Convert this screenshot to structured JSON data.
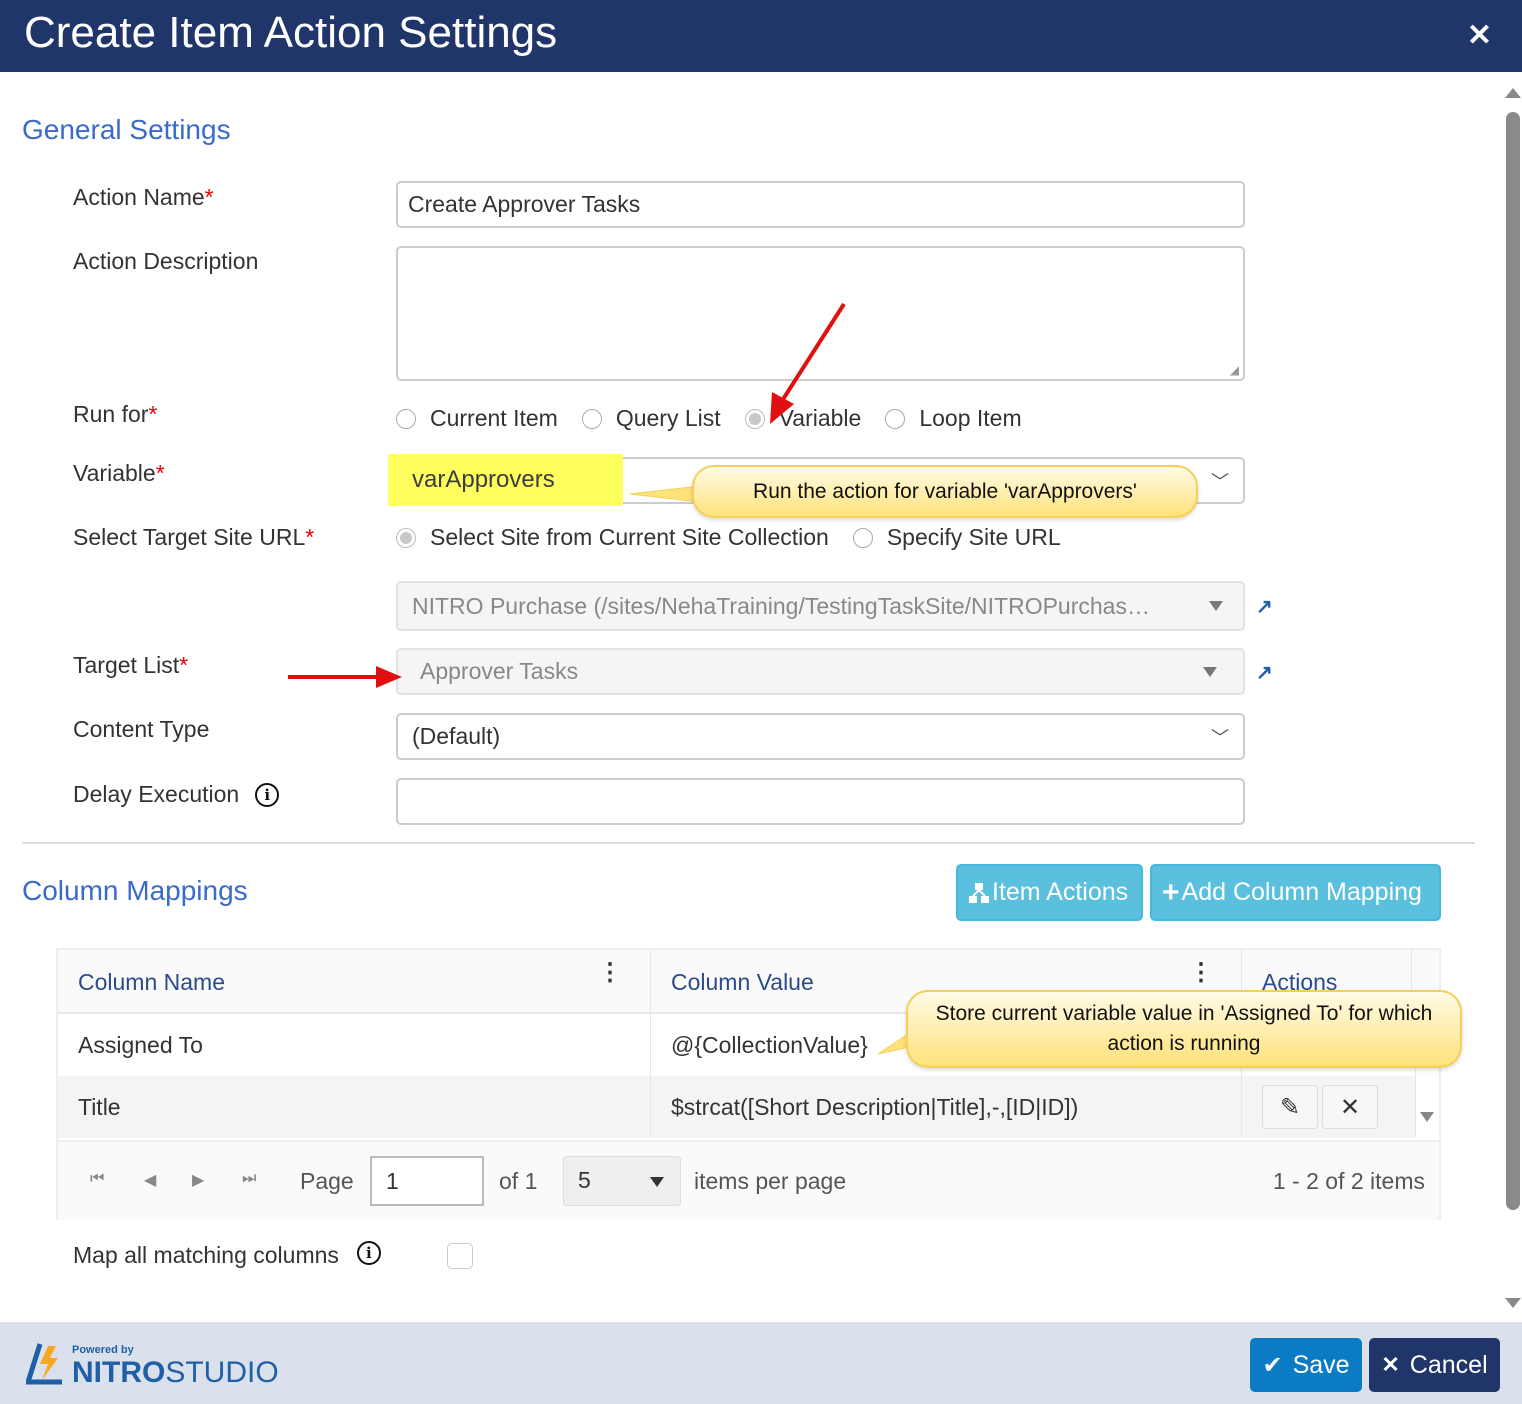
{
  "dialog": {
    "title": "Create Item Action Settings",
    "close_glyph": "✕"
  },
  "general": {
    "section_title": "General Settings",
    "action_name": {
      "label": "Action Name",
      "required": "*",
      "value": "Create Approver Tasks"
    },
    "action_description": {
      "label": "Action Description",
      "value": ""
    },
    "run_for": {
      "label": "Run for",
      "required": "*",
      "options": [
        "Current Item",
        "Query List",
        "Variable",
        "Loop Item"
      ],
      "selected": "Variable"
    },
    "variable": {
      "label": "Variable",
      "required": "*",
      "value": "varApprovers",
      "highlight_color": "#ffff66"
    },
    "target_site": {
      "label": "Select Target Site URL",
      "required": "*",
      "options": [
        "Select Site from Current Site Collection",
        "Specify Site URL"
      ],
      "selected": "Select Site from Current Site Collection",
      "site_value": "NITRO Purchase (/sites/NehaTraining/TestingTaskSite/NITROPurchas…"
    },
    "target_list": {
      "label": "Target List",
      "required": "*",
      "value": "Approver Tasks"
    },
    "content_type": {
      "label": "Content Type",
      "value": "(Default)"
    },
    "delay_execution": {
      "label": "Delay Execution",
      "value": ""
    }
  },
  "callouts": {
    "variable_note": "Run the action for variable 'varApprovers'",
    "mapping_note": "Store current variable value in 'Assigned To' for which action is running"
  },
  "mappings": {
    "section_title": "Column Mappings",
    "item_actions_label": "Item Actions",
    "add_mapping_label": "Add Column Mapping",
    "columns": [
      "Column Name",
      "Column Value",
      "Actions"
    ],
    "rows": [
      {
        "name": "Assigned To",
        "value": "@{CollectionValue}"
      },
      {
        "name": "Title",
        "value": "$strcat([Short Description|Title],-,[ID|ID])"
      }
    ],
    "pager": {
      "page_label": "Page",
      "page_value": "1",
      "of_label": "of 1",
      "page_size": "5",
      "items_per_page_label": "items per page",
      "summary": "1 - 2 of 2 items"
    },
    "map_all_label": "Map all matching columns",
    "map_all_checked": false
  },
  "footer": {
    "powered_by": "Powered by",
    "brand_bold": "NITRO",
    "brand_light": "STUDIO",
    "save_label": "Save",
    "cancel_label": "Cancel"
  },
  "colors": {
    "header_bg": "#20366b",
    "section_title": "#3a6bc9",
    "info_button": "#5bc0de",
    "save_button": "#0a7bc4",
    "cancel_button": "#20366b",
    "annotation_arrow": "#e01010"
  }
}
